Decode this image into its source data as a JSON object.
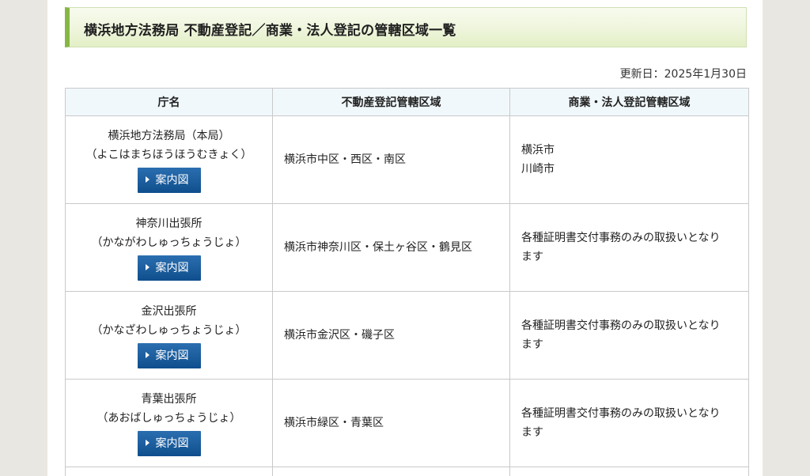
{
  "page": {
    "title": "横浜地方法務局 不動産登記／商業・法人登記の管轄区域一覧",
    "updated": "更新日：2025年1月30日"
  },
  "table": {
    "headers": [
      "庁名",
      "不動産登記管轄区域",
      "商業・法人登記管轄区域"
    ],
    "rows": [
      {
        "office": "横浜地方法務局（本局）",
        "reading": "（よこはまちほうほうむきょく）",
        "map_button": "案内図",
        "real_estate": "横浜市中区・西区・南区",
        "commercial": [
          "横浜市",
          "川崎市"
        ]
      },
      {
        "office": "神奈川出張所",
        "reading": "（かながわしゅっちょうじょ）",
        "map_button": "案内図",
        "real_estate": "横浜市神奈川区・保土ヶ谷区・鶴見区",
        "commercial": [
          "各種証明書交付事務のみの取扱いとなり",
          "ます"
        ]
      },
      {
        "office": "金沢出張所",
        "reading": "（かなざわしゅっちょうじょ）",
        "map_button": "案内図",
        "real_estate": "横浜市金沢区・磯子区",
        "commercial": [
          "各種証明書交付事務のみの取扱いとなり",
          "ます"
        ]
      },
      {
        "office": "青葉出張所",
        "reading": "（あおばしゅっちょうじょ）",
        "map_button": "案内図",
        "real_estate": "横浜市緑区・青葉区",
        "commercial": [
          "各種証明書交付事務のみの取扱いとなり",
          "ます"
        ]
      }
    ]
  },
  "colors": {
    "title_accent": "#86b744",
    "header_bg": "#f1f8fb",
    "button_bg": "#0f4e8d"
  }
}
